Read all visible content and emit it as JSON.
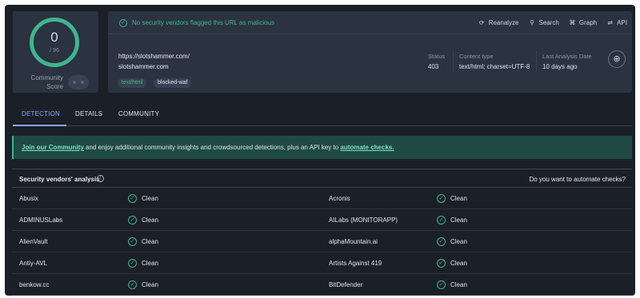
{
  "score": {
    "value": "0",
    "total": "/ 96",
    "label": "Community Score"
  },
  "banner": {
    "message": "No security vendors flagged this URL as malicious",
    "status_color": "#3fb58e"
  },
  "actions": [
    {
      "label": "Reanalyze",
      "icon": "refresh-icon"
    },
    {
      "label": "Search",
      "icon": "search-icon"
    },
    {
      "label": "Graph",
      "icon": "graph-icon"
    },
    {
      "label": "API",
      "icon": "api-icon"
    }
  ],
  "target": {
    "url": "https://slotshammer.com/",
    "host": "slotshammer.com"
  },
  "tags": [
    "text/html",
    "blocked-waf"
  ],
  "meta": {
    "status": {
      "label": "Status",
      "value": "403"
    },
    "content_type": {
      "label": "Content type",
      "value": "text/html; charset=UTF-8"
    },
    "last_analysis": {
      "label": "Last Analysis Date",
      "value": "10 days ago"
    }
  },
  "tabs": [
    "DETECTION",
    "DETAILS",
    "COMMUNITY"
  ],
  "notice": {
    "link1": "Join our Community",
    "middle": " and enjoy additional community insights and crowdsourced detections, plus an API key to ",
    "link2": "automate checks."
  },
  "analysis": {
    "title": "Security vendors' analysis",
    "automate_prompt": "Do you want to automate checks?",
    "rows": [
      {
        "left_vendor": "Abusix",
        "left_result": "Clean",
        "right_vendor": "Acronis",
        "right_result": "Clean"
      },
      {
        "left_vendor": "ADMINUSLabs",
        "left_result": "Clean",
        "right_vendor": "AILabs (MONITORAPP)",
        "right_result": "Clean"
      },
      {
        "left_vendor": "AlienVault",
        "left_result": "Clean",
        "right_vendor": "alphaMountain.ai",
        "right_result": "Clean"
      },
      {
        "left_vendor": "Antiy-AVL",
        "left_result": "Clean",
        "right_vendor": "Artists Against 419",
        "right_result": "Clean"
      },
      {
        "left_vendor": "benkow.cc",
        "left_result": "Clean",
        "right_vendor": "BitDefender",
        "right_result": "Clean"
      }
    ]
  },
  "colors": {
    "accent": "#8ea3ff",
    "clean": "#3fb58e",
    "panel": "#2b3240",
    "background": "#1b1f27"
  }
}
